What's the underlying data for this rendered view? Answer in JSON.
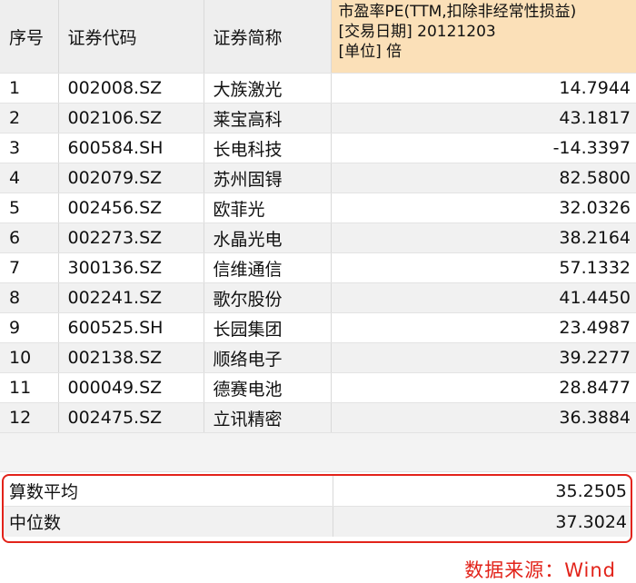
{
  "table": {
    "headers": {
      "index": "序号",
      "code": "证券代码",
      "name": "证券简称",
      "pe_line1": "市盈率PE(TTM,扣除非经常性损益)",
      "pe_line2": "[交易日期] 20121203",
      "pe_line3": "[单位] 倍"
    },
    "rows": [
      {
        "index": "1",
        "code": "002008.SZ",
        "name": "大族激光",
        "pe": "14.7944"
      },
      {
        "index": "2",
        "code": "002106.SZ",
        "name": "莱宝高科",
        "pe": "43.1817"
      },
      {
        "index": "3",
        "code": "600584.SH",
        "name": "长电科技",
        "pe": "-14.3397"
      },
      {
        "index": "4",
        "code": "002079.SZ",
        "name": "苏州固锝",
        "pe": "82.5800"
      },
      {
        "index": "5",
        "code": "002456.SZ",
        "name": "欧菲光",
        "pe": "32.0326"
      },
      {
        "index": "6",
        "code": "002273.SZ",
        "name": "水晶光电",
        "pe": "38.2164"
      },
      {
        "index": "7",
        "code": "300136.SZ",
        "name": "信维通信",
        "pe": "57.1332"
      },
      {
        "index": "8",
        "code": "002241.SZ",
        "name": "歌尔股份",
        "pe": "41.4450"
      },
      {
        "index": "9",
        "code": "600525.SH",
        "name": "长园集团",
        "pe": "23.4987"
      },
      {
        "index": "10",
        "code": "002138.SZ",
        "name": "顺络电子",
        "pe": "39.2277"
      },
      {
        "index": "11",
        "code": "000049.SZ",
        "name": "德赛电池",
        "pe": "28.8477"
      },
      {
        "index": "12",
        "code": "002475.SZ",
        "name": "立讯精密",
        "pe": "36.3884"
      }
    ]
  },
  "summary": {
    "mean_label": "算数平均",
    "mean_value": "35.2505",
    "median_label": "中位数",
    "median_value": "37.3024"
  },
  "source": "数据来源：Wind",
  "colors": {
    "header_highlight": "#fbe0b8",
    "summary_border": "#e2231a",
    "source_text": "#e2231a"
  }
}
